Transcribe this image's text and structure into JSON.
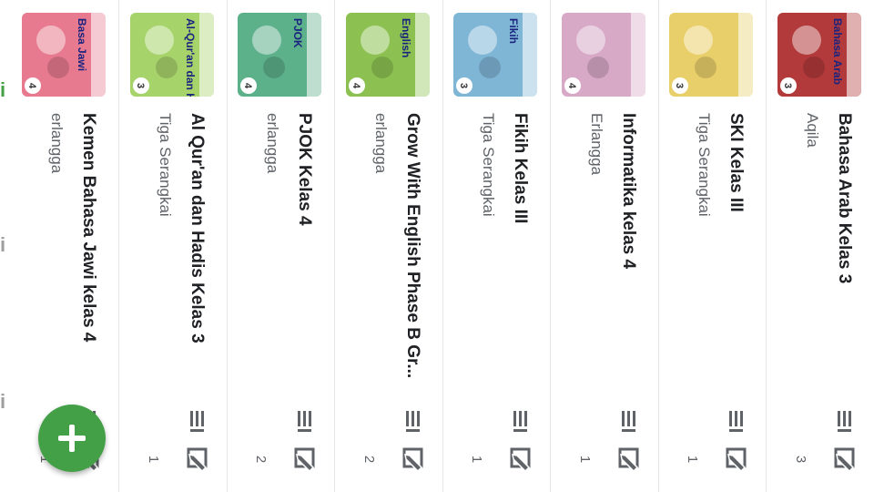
{
  "colors": {
    "accent": "#43a047",
    "text": "#202124",
    "secondary": "#5f6368"
  },
  "left_strip": {
    "marks": [
      "i",
      "i",
      "i"
    ]
  },
  "books": [
    {
      "title": "Bahasa Arab Kelas 3",
      "author": "Aqila",
      "count": "3",
      "cover_text": "Bahasa Arab",
      "cover_color": "#b23a3a",
      "cover_badge": "3"
    },
    {
      "title": "SKI Kelas III",
      "author": "Tiga Serangkai",
      "count": "1",
      "cover_text": "",
      "cover_color": "#e9cf6a",
      "cover_badge": "3"
    },
    {
      "title": "Informatika kelas 4",
      "author": "Erlangga",
      "count": "1",
      "cover_text": "",
      "cover_color": "#d7a9c6",
      "cover_badge": "4"
    },
    {
      "title": "Fikih Kelas III",
      "author": "Tiga Serangkai",
      "count": "1",
      "cover_text": "Fikih",
      "cover_color": "#7fb6d6",
      "cover_badge": "3"
    },
    {
      "title": "Grow With English Phase B Gr...",
      "author": "erlangga",
      "count": "2",
      "cover_text": "English",
      "cover_color": "#8cc152",
      "cover_badge": "4"
    },
    {
      "title": "PJOK Kelas 4",
      "author": "erlangga",
      "count": "2",
      "cover_text": "PJOK",
      "cover_color": "#5cb08a",
      "cover_badge": "4"
    },
    {
      "title": "Al Qur'an dan Hadis Kelas 3",
      "author": "Tiga Serangkai",
      "count": "1",
      "cover_text": "Al-Qur'an dan Hadis",
      "cover_color": "#a7d36b",
      "cover_badge": "3"
    },
    {
      "title": "Kemen Bahasa Jawi kelas 4",
      "author": "erlangga",
      "count": "1",
      "cover_text": "Basa Jawi",
      "cover_color": "#e77a8f",
      "cover_badge": "4"
    }
  ],
  "icons": {
    "list": "list-view-icon",
    "edit": "edit-icon",
    "add": "plus-icon"
  }
}
